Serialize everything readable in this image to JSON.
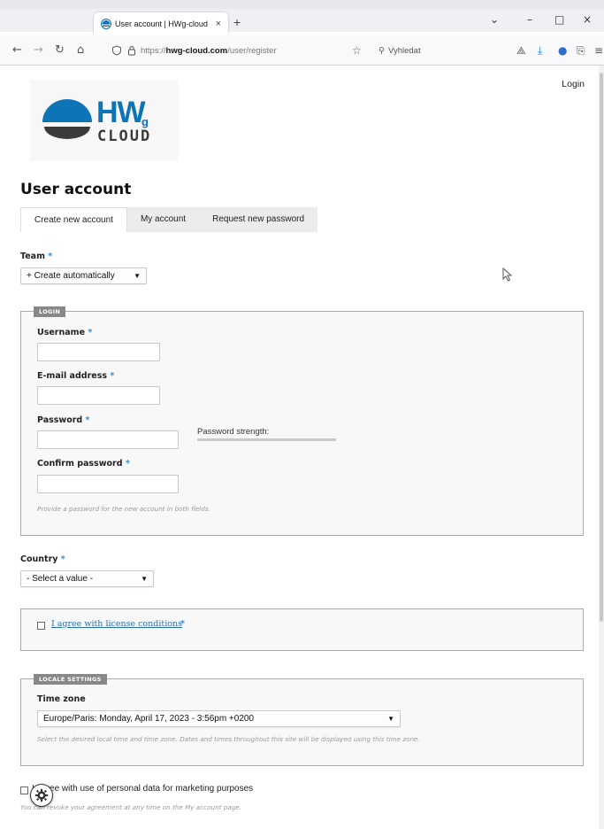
{
  "browser": {
    "tab_title": "User account | HWg-cloud",
    "tab_close": "×",
    "new_tab": "+",
    "url_pre": "https://",
    "url_host": "hwg-cloud.com",
    "url_path": "/user/register",
    "search_placeholder": "Vyhledat",
    "window_controls": {
      "dropdown": "⌄",
      "minimize": "–",
      "maximize": "□",
      "close": "×"
    }
  },
  "header": {
    "login_link": "Login",
    "logo": {
      "hw": "HW",
      "g": "g",
      "cloud": "CLOUD"
    }
  },
  "page": {
    "title": "User account",
    "tabs": [
      {
        "label": "Create new account",
        "active": true
      },
      {
        "label": "My account",
        "active": false
      },
      {
        "label": "Request new password",
        "active": false
      }
    ]
  },
  "form": {
    "required_mark": "*",
    "team": {
      "label": "Team",
      "value": "+ Create automatically"
    },
    "login_fieldset": {
      "legend": "LOGIN",
      "username_label": "Username",
      "username_value": "",
      "email_label": "E-mail address",
      "email_value": "",
      "password_label": "Password",
      "password_value": "",
      "password_strength_label": "Password strength:",
      "password_strength": 0,
      "confirm_password_label": "Confirm password",
      "confirm_password_value": "",
      "help": "Provide a password for the new account in both fields."
    },
    "country": {
      "label": "Country",
      "value": "- Select a value -"
    },
    "license": {
      "label": "I agree with license conditions",
      "checked": false
    },
    "locale_fieldset": {
      "legend": "LOCALE SETTINGS",
      "timezone_label": "Time zone",
      "timezone_value": "Europe/Paris: Monday, April 17, 2023 - 3:56pm +0200",
      "help": "Select the desired local time and time zone. Dates and times throughout this site will be displayed using this time zone."
    },
    "marketing": {
      "label": "I agree with use of personal data for marketing purposes",
      "checked": false,
      "help": "You can revoke your agreement at any time on the My account page."
    }
  },
  "colors": {
    "accent": "#0e74b8",
    "required": "#3b8dc9",
    "link": "#2b6fa8",
    "legend_bg": "#888888"
  },
  "icons": [
    "back-arrow-icon",
    "forward-arrow-icon",
    "reload-icon",
    "home-icon",
    "shield-icon",
    "lock-icon",
    "star-icon",
    "search-icon",
    "save-to-pocket-icon",
    "download-icon",
    "extension-icon",
    "share-icon",
    "menu-icon",
    "gear-icon",
    "cursor-icon"
  ]
}
